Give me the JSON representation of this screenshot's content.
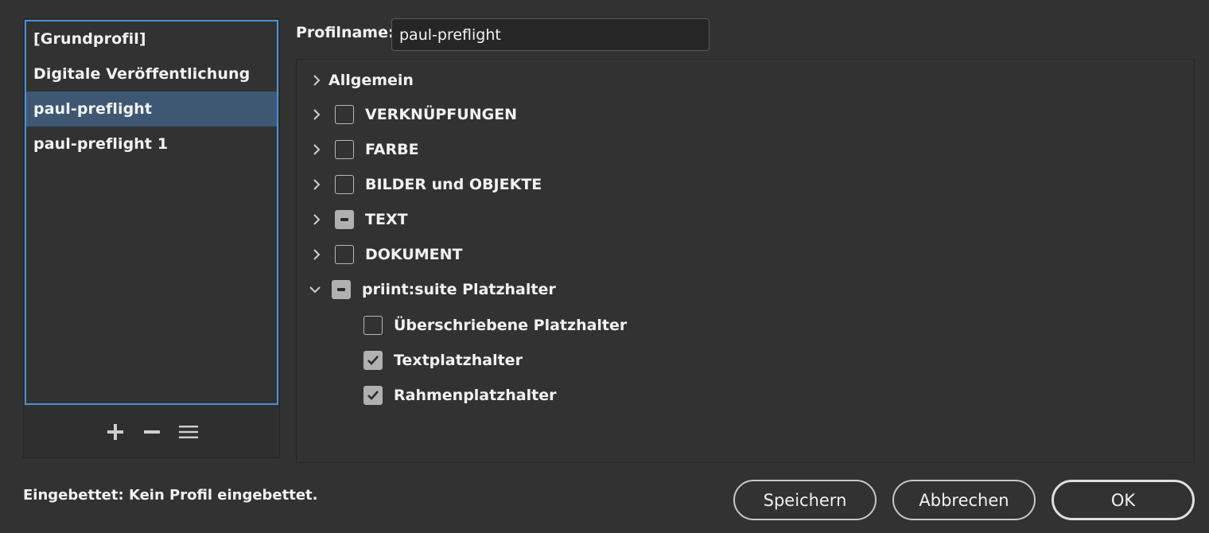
{
  "profiles": {
    "items": [
      {
        "label": "[Grundprofil]"
      },
      {
        "label": "Digitale Veröffentlichung"
      },
      {
        "label": "paul-preflight",
        "selected": true
      },
      {
        "label": "paul-preflight 1"
      }
    ]
  },
  "profile_name": {
    "label": "Profilname:",
    "value": "paul-preflight"
  },
  "tree": {
    "rows": [
      {
        "label": "Allgemein",
        "expanded": false,
        "checkbox": "none"
      },
      {
        "label": "VERKNÜPFUNGEN",
        "expanded": false,
        "checkbox": "unchecked"
      },
      {
        "label": "FARBE",
        "expanded": false,
        "checkbox": "unchecked"
      },
      {
        "label": "BILDER und OBJEKTE",
        "expanded": false,
        "checkbox": "unchecked"
      },
      {
        "label": "TEXT",
        "expanded": false,
        "checkbox": "mixed"
      },
      {
        "label": "DOKUMENT",
        "expanded": false,
        "checkbox": "unchecked"
      },
      {
        "label": "priint:suite Platzhalter",
        "expanded": true,
        "checkbox": "mixed"
      },
      {
        "label": "Überschriebene Platzhalter",
        "checkbox": "unchecked"
      },
      {
        "label": "Textplatzhalter",
        "checkbox": "checked"
      },
      {
        "label": "Rahmenplatzhalter",
        "checkbox": "checked"
      }
    ]
  },
  "status_text": "Eingebettet: Kein Profil eingebettet.",
  "buttons": {
    "save": "Speichern",
    "cancel": "Abbrechen",
    "ok": "OK"
  },
  "colors": {
    "background": "#323232",
    "selection": "#3e5874",
    "focus_border": "#4a90d6"
  }
}
